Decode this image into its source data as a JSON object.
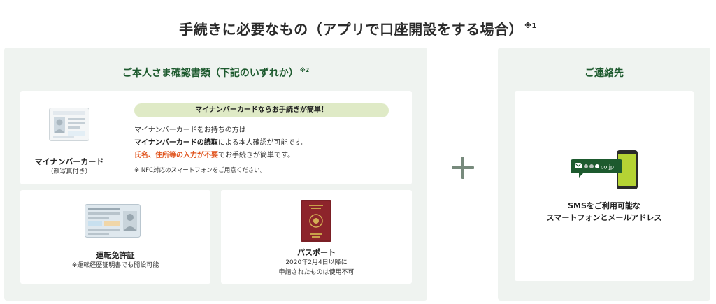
{
  "page": {
    "title": "手続きに必要なもの（アプリで口座開設をする場合）",
    "title_note": "※1"
  },
  "identity_panel": {
    "heading": "ご本人さま確認書類（下記のいずれか）",
    "heading_note": "※2",
    "my_number": {
      "name": "マイナンバーカード",
      "sub": "（顔写真付き）",
      "banner": "マイナンバーカードならお手続きが簡単！",
      "line1": "マイナンバーカードをお持ちの方は",
      "line2_bold": "マイナンバーカードの読取",
      "line2_rest": "による本人確認が可能です。",
      "line3_emph": "氏名、住所等の入力が不要",
      "line3_rest": "でお手続きが簡単です。",
      "nfc_note": "※ NFC対応のスマートフォンをご用意ください。"
    },
    "license": {
      "name": "運転免許証",
      "note": "※運転経歴証明書でも開設可能"
    },
    "passport": {
      "name": "パスポート",
      "note1": "2020年2月4日以降に",
      "note2": "申請されたものは使用不可",
      "cover_text": "JAPAN"
    }
  },
  "contact_panel": {
    "heading": "ご連絡先",
    "sms_bubble": "●●@co.jp",
    "line1": "SMSをご利用可能な",
    "line2": "スマートフォンとメールアドレス"
  },
  "colors": {
    "panel_bg": "#eff3f0",
    "heading_green": "#1d5a2e",
    "pill_bg": "#dfeac6",
    "emphasis_orange": "#e0541d",
    "phone_green": "#b5d334",
    "bubble_green": "#1d5a2e",
    "plus_gray": "#778a7c"
  }
}
